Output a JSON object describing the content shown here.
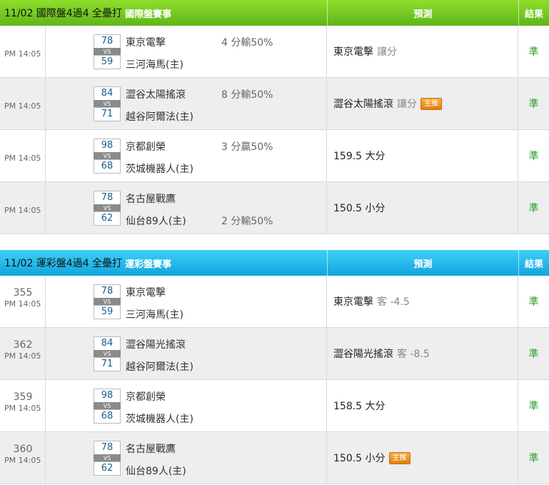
{
  "columns": {
    "prediction": "預測",
    "result": "結果"
  },
  "sections": [
    {
      "title": "11/02 國際盤4過4 全壘打",
      "badge": "國際盤賽事",
      "rows": [
        {
          "num": "",
          "time": "PM 14:05",
          "score1": "78",
          "score2": "59",
          "team1": "東京電擊",
          "team2": "三河海馬(主)",
          "handicap_top": "4 分輸50%",
          "handicap_bot": "",
          "pick": "東京電擊",
          "pick_sub": "讓分",
          "star": "",
          "result": "準"
        },
        {
          "num": "",
          "time": "PM 14:05",
          "score1": "84",
          "score2": "71",
          "team1": "澀谷太陽搖滾",
          "team2": "越谷阿爾法(主)",
          "handicap_top": "8 分輸50%",
          "handicap_bot": "",
          "pick": "澀谷太陽搖滾",
          "pick_sub": "讓分",
          "star": "主推",
          "result": "準"
        },
        {
          "num": "",
          "time": "PM 14:05",
          "score1": "98",
          "score2": "68",
          "team1": "京都創榮",
          "team2": "茨城機器人(主)",
          "handicap_top": "3 分贏50%",
          "handicap_bot": "",
          "pick": "159.5 大分",
          "pick_sub": "",
          "star": "",
          "result": "準"
        },
        {
          "num": "",
          "time": "PM 14:05",
          "score1": "78",
          "score2": "62",
          "team1": "名古屋戰鷹",
          "team2": "仙台89人(主)",
          "handicap_top": "",
          "handicap_bot": "2 分輸50%",
          "pick": "150.5 小分",
          "pick_sub": "",
          "star": "",
          "result": "準"
        }
      ]
    },
    {
      "title": "11/02 運彩盤4過4 全壘打",
      "badge": "運彩盤賽事",
      "rows": [
        {
          "num": "355",
          "time": "PM 14:05",
          "score1": "78",
          "score2": "59",
          "team1": "東京電擊",
          "team2": "三河海馬(主)",
          "handicap_top": "",
          "handicap_bot": "",
          "pick": "東京電擊",
          "pick_sub": "客 -4.5",
          "star": "",
          "result": "準"
        },
        {
          "num": "362",
          "time": "PM 14:05",
          "score1": "84",
          "score2": "71",
          "team1": "澀谷陽光搖滾",
          "team2": "越谷阿爾法(主)",
          "handicap_top": "",
          "handicap_bot": "",
          "pick": "澀谷陽光搖滾",
          "pick_sub": "客 -8.5",
          "star": "",
          "result": "準"
        },
        {
          "num": "359",
          "time": "PM 14:05",
          "score1": "98",
          "score2": "68",
          "team1": "京都創榮",
          "team2": "茨城機器人(主)",
          "handicap_top": "",
          "handicap_bot": "",
          "pick": "158.5 大分",
          "pick_sub": "",
          "star": "",
          "result": "準"
        },
        {
          "num": "360",
          "time": "PM 14:05",
          "score1": "78",
          "score2": "62",
          "team1": "名古屋戰鷹",
          "team2": "仙台89人(主)",
          "handicap_top": "",
          "handicap_bot": "",
          "pick": "150.5 小分",
          "pick_sub": "",
          "star": "主推",
          "result": "準"
        }
      ]
    }
  ]
}
